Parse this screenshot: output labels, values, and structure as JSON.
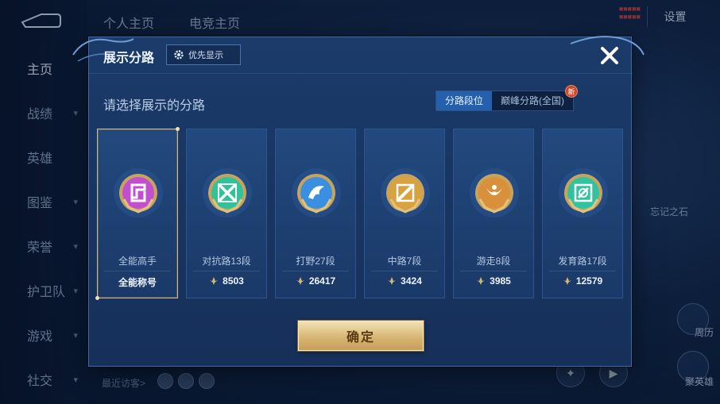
{
  "background": {
    "nav": [
      {
        "label": "主页",
        "active": true,
        "chevron": false
      },
      {
        "label": "战绩",
        "active": false,
        "chevron": true
      },
      {
        "label": "英雄",
        "active": false,
        "chevron": false
      },
      {
        "label": "图鉴",
        "active": false,
        "chevron": true
      },
      {
        "label": "荣誉",
        "active": false,
        "chevron": true
      },
      {
        "label": "护卫队",
        "active": false,
        "chevron": true
      },
      {
        "label": "游戏",
        "active": false,
        "chevron": true
      },
      {
        "label": "社交",
        "active": false,
        "chevron": true
      }
    ],
    "tabs": [
      "个人主页",
      "电竞主页"
    ],
    "settings_label": "设置",
    "recent_visitors_label": "最近访客>",
    "side_text": "忘记之石",
    "right_labels": [
      "周历",
      "聚英雄"
    ]
  },
  "modal": {
    "title": "展示分路",
    "priority_label": "优先显示",
    "prompt": "请选择展示的分路",
    "segments": [
      {
        "label": "分路段位",
        "active": true
      },
      {
        "label": "巅峰分路(全国)",
        "active": false,
        "badge": "新"
      }
    ],
    "cards": [
      {
        "name": "全能高手",
        "value": "全能称号",
        "selected": true,
        "icon": "all-round-badge-icon",
        "color": "#c24fd0",
        "show_points_icon": false
      },
      {
        "name": "对抗路13段",
        "value": "8503",
        "selected": false,
        "icon": "clash-lane-badge-icon",
        "color": "#2fc39a",
        "show_points_icon": true
      },
      {
        "name": "打野27段",
        "value": "26417",
        "selected": false,
        "icon": "jungle-badge-icon",
        "color": "#3a8fe0",
        "show_points_icon": true
      },
      {
        "name": "中路7段",
        "value": "3424",
        "selected": false,
        "icon": "mid-lane-badge-icon",
        "color": "#d8a33e",
        "show_points_icon": true
      },
      {
        "name": "游走8段",
        "value": "3985",
        "selected": false,
        "icon": "roam-badge-icon",
        "color": "#d8913a",
        "show_points_icon": true
      },
      {
        "name": "发育路17段",
        "value": "12579",
        "selected": false,
        "icon": "farm-lane-badge-icon",
        "color": "#2fc3a0",
        "show_points_icon": true
      }
    ],
    "confirm_label": "确定"
  }
}
